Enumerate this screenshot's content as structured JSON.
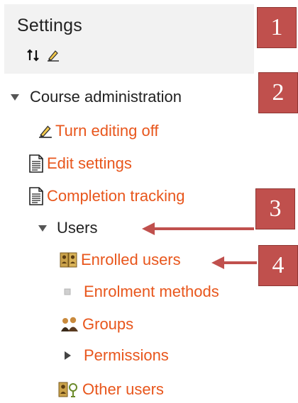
{
  "header": {
    "title": "Settings",
    "icons": [
      "move-icon",
      "edit-icon"
    ]
  },
  "tree": {
    "course_admin": "Course administration",
    "turn_editing": "Turn editing off",
    "edit_settings": "Edit settings",
    "completion_tracking": "Completion tracking",
    "users": "Users",
    "enrolled_users": "Enrolled users",
    "enrolment_methods": "Enrolment methods",
    "groups": "Groups",
    "permissions": "Permissions",
    "other_users": "Other users"
  },
  "callouts": {
    "c1": "1",
    "c2": "2",
    "c3": "3",
    "c4": "4"
  },
  "colors": {
    "link": "#e8561c",
    "callout": "#c0504d",
    "header_bg": "#f2f2f2",
    "text": "#222222"
  }
}
